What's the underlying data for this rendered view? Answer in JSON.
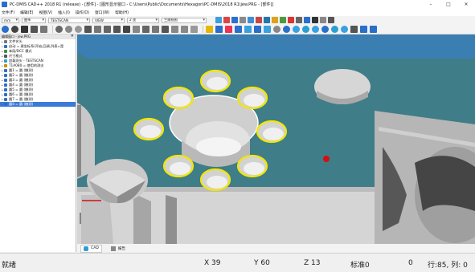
{
  "window": {
    "title": "PC-DMIS CAD++ 2018 R1 (release) - [部件] - [图形显示窗口 - C:\\Users\\Public\\Documents\\Hexagon\\PC-DMIS\\2018 R1\\jew.PRG - [部件]]",
    "min": "–",
    "max": "□",
    "close": "✕"
  },
  "menu": [
    "文件(F)",
    "编辑(E)",
    "视图(V)",
    "插入(I)",
    "操作(O)",
    "窗口(W)",
    "帮助(H)"
  ],
  "toolbar1": {
    "combos": [
      "mm",
      "曲率",
      "TESTSCAN",
      "VIEW",
      "2 坐",
      "三维视图"
    ]
  },
  "tree": {
    "header": "编辑窗口 - jew.PRG",
    "close": "✕",
    "items": [
      {
        "label": "文件名头",
        "selected": false
      },
      {
        "label": "启动 = 建坐标系/开始,回调,列表=是",
        "selected": false
      },
      {
        "label": "本段/DCC 模式",
        "selected": false
      },
      {
        "label": "尺寸格式",
        "selected": false
      },
      {
        "label": "加载测头 - TESTSCAN",
        "selected": false
      },
      {
        "label": "T1A0B0 = 使用的测尖",
        "selected": false
      },
      {
        "label": "圆1 = 圆 (触测)",
        "selected": false
      },
      {
        "label": "圆2 = 圆 (触测)",
        "selected": false
      },
      {
        "label": "圆3 = 圆 (触测)",
        "selected": false
      },
      {
        "label": "圆4 = 圆 (触测)",
        "selected": false
      },
      {
        "label": "圆5 = 圆 (触测)",
        "selected": false
      },
      {
        "label": "圆6 = 圆 (触测)",
        "selected": false
      },
      {
        "label": "圆7 = 圆 (触测)",
        "selected": false
      },
      {
        "label": "圆8 = 圆 (触测)",
        "selected": true
      }
    ]
  },
  "tabs": [
    {
      "label": "CAD",
      "active": true
    },
    {
      "label": "报告",
      "active": false
    }
  ],
  "status": {
    "ready": "就绪",
    "x": "X 39",
    "y": "Y 60",
    "z": "Z 13",
    "std": "标准0",
    "zero": "0",
    "rowcol": "行:85, 列: 0"
  },
  "colors": {
    "surface": "#3f7d88",
    "wall": "#b9b9b9",
    "highlight": "#f3e600",
    "background": "#3b7eb1"
  }
}
